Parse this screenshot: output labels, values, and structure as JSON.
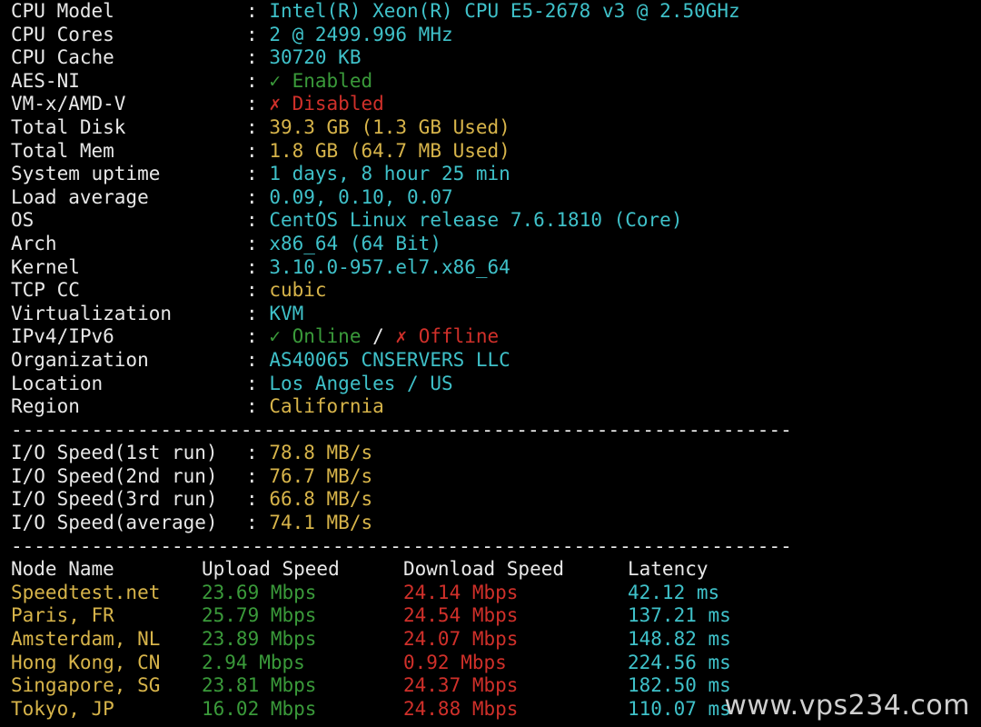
{
  "colors": {
    "background": "#000000",
    "label": "#e8e8e8",
    "value_cyan": "#3fc1c9",
    "value_yellow": "#d7b44a",
    "ok_green": "#3a9a3a",
    "bad_red": "#d0302a"
  },
  "separator": ":",
  "divider": "----------------------------------------------------------------------",
  "sysinfo": [
    {
      "label": "CPU Model",
      "value": "Intel(R) Xeon(R) CPU E5-2678 v3 @ 2.50GHz",
      "color": "cyan"
    },
    {
      "label": "CPU Cores",
      "value": "2 @ 2499.996 MHz",
      "color": "cyan"
    },
    {
      "label": "CPU Cache",
      "value": "30720 KB",
      "color": "cyan"
    },
    {
      "label": "AES-NI",
      "value": "✓ Enabled",
      "color": "green"
    },
    {
      "label": "VM-x/AMD-V",
      "value": "✗ Disabled",
      "color": "red"
    },
    {
      "label": "Total Disk",
      "value": "39.3 GB (1.3 GB Used)",
      "color": "yellow"
    },
    {
      "label": "Total Mem",
      "value": "1.8 GB (64.7 MB Used)",
      "color": "yellow"
    },
    {
      "label": "System uptime",
      "value": "1 days, 8 hour 25 min",
      "color": "cyan"
    },
    {
      "label": "Load average",
      "value": "0.09, 0.10, 0.07",
      "color": "cyan"
    },
    {
      "label": "OS",
      "value": "CentOS Linux release 7.6.1810 (Core)",
      "color": "cyan"
    },
    {
      "label": "Arch",
      "value": "x86_64 (64 Bit)",
      "color": "cyan"
    },
    {
      "label": "Kernel",
      "value": "3.10.0-957.el7.x86_64",
      "color": "cyan"
    },
    {
      "label": "TCP CC",
      "value": "cubic",
      "color": "yellow"
    },
    {
      "label": "Virtualization",
      "value": "KVM",
      "color": "cyan"
    }
  ],
  "ip": {
    "label": "IPv4/IPv6",
    "ipv4": "✓ Online",
    "slash": " / ",
    "ipv6": "✗ Offline"
  },
  "geo": [
    {
      "label": "Organization",
      "value": "AS40065 CNSERVERS LLC",
      "color": "cyan"
    },
    {
      "label": "Location",
      "value": "Los Angeles / US",
      "color": "cyan"
    },
    {
      "label": "Region",
      "value": "California",
      "color": "yellow"
    }
  ],
  "io": [
    {
      "label": "I/O Speed(1st run)",
      "value": "78.8 MB/s"
    },
    {
      "label": "I/O Speed(2nd run)",
      "value": "76.7 MB/s"
    },
    {
      "label": "I/O Speed(3rd run)",
      "value": "66.8 MB/s"
    },
    {
      "label": "I/O Speed(average)",
      "value": "74.1 MB/s"
    }
  ],
  "speed": {
    "headers": {
      "node": "Node Name",
      "upload": "Upload Speed",
      "download": "Download Speed",
      "latency": "Latency"
    },
    "rows": [
      {
        "node": "Speedtest.net",
        "upload": "23.69 Mbps",
        "download": "24.14 Mbps",
        "latency": "42.12 ms"
      },
      {
        "node": "Paris, FR",
        "upload": "25.79 Mbps",
        "download": "24.54 Mbps",
        "latency": "137.21 ms"
      },
      {
        "node": "Amsterdam, NL",
        "upload": "23.89 Mbps",
        "download": "24.07 Mbps",
        "latency": "148.82 ms"
      },
      {
        "node": "Hong Kong, CN",
        "upload": "2.94 Mbps",
        "download": "0.92 Mbps",
        "latency": "224.56 ms"
      },
      {
        "node": "Singapore, SG",
        "upload": "23.81 Mbps",
        "download": "24.37 Mbps",
        "latency": "182.50 ms"
      },
      {
        "node": "Tokyo, JP",
        "upload": "16.02 Mbps",
        "download": "24.88 Mbps",
        "latency": "110.07 ms"
      }
    ]
  },
  "watermark": "www.vps234.com"
}
